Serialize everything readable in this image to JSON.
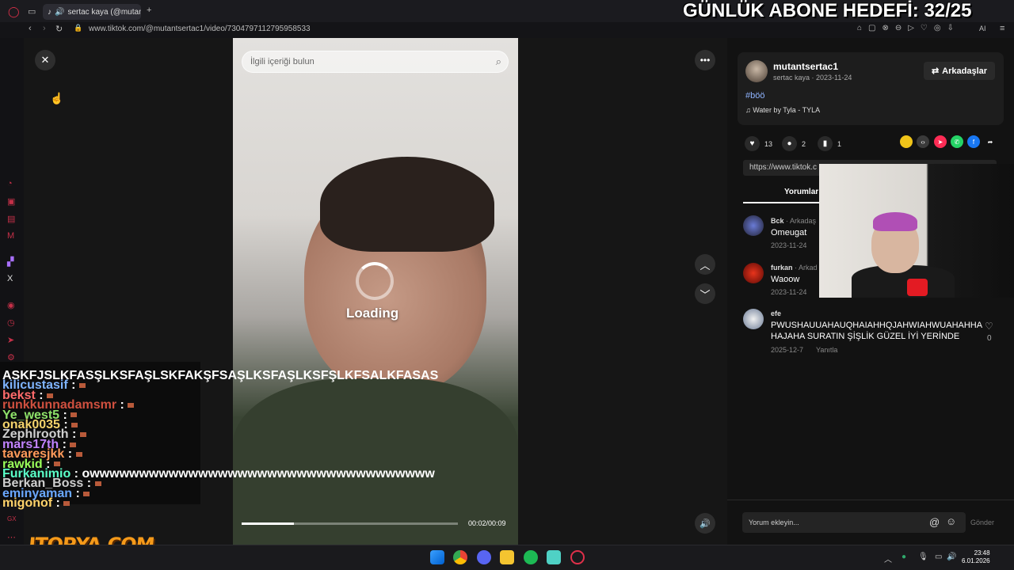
{
  "browser": {
    "tab_title": "sertac kaya (@mutantse",
    "url": "www.tiktok.com/@mutantsertac1/video/7304797112795958533",
    "new_tab_label": "+"
  },
  "overlay": {
    "headline": "GÜNLÜK ABONE HEDEFİ: 32/25",
    "sponsor_logo": "ITOPYA.COM"
  },
  "video": {
    "search_placeholder": "İlgili içeriği bulun",
    "loading_text": "Loading",
    "time": "00:02/00:09",
    "progress": 0.24
  },
  "author": {
    "username": "mutantsertac1",
    "nickname": "sertac kaya · 2023-11-24",
    "friends_button": "Arkadaşlar",
    "hashtag": "#böö",
    "music": "Water by Tyla - TYLA"
  },
  "stats": {
    "likes": "13",
    "comments": "2",
    "saves": "1"
  },
  "share_colors": [
    "#f0c419",
    "#3a3a3a",
    "#fe2c55",
    "#25d366",
    "#1877f2",
    "#3a3a3a"
  ],
  "link_text": "https://www.tiktok.c",
  "comments_tab": "Yorumlar",
  "comments": [
    {
      "user": "Bck",
      "badge": "· Arkadaş",
      "text": "Omeugat",
      "date": "2023-11-24"
    },
    {
      "user": "furkan",
      "badge": "· Arkad",
      "text": "Waoow",
      "date": "2023-11-24"
    },
    {
      "user": "efe",
      "badge": "",
      "text": "PWUSHAUUAHAUQHAIAHHQJAHWIAHWUAHAHHA HAJAHA SURATIN ŞİŞLİK GÜZEL İYİ YERİNDE",
      "date": "2025-12-7",
      "reply": "Yanıtla",
      "likes": "0"
    }
  ],
  "comment_input": {
    "placeholder": "Yorum ekleyin...",
    "send": "Gönder"
  },
  "chat": [
    {
      "user": "ASKFJSLKFASŞLKSFAŞLSKFAKŞFSAŞLKSFAŞLKSFŞLKFSALKFASAS",
      "color": "#ffffff",
      "msg": ""
    },
    {
      "user": "kilicustasif",
      "color": "#7fb4ff",
      "msg": ":"
    },
    {
      "user": "bekst",
      "color": "#ff6b6b",
      "msg": ":"
    },
    {
      "user": "runkkunnadamsmr",
      "color": "#d0503f",
      "msg": ":"
    },
    {
      "user": "Ye_west5",
      "color": "#8fe36a",
      "msg": ":"
    },
    {
      "user": "onak0035",
      "color": "#f4d36b",
      "msg": ":"
    },
    {
      "user": "Zephlrooth",
      "color": "#cfcfcf",
      "msg": ":"
    },
    {
      "user": "mars17th",
      "color": "#c183ff",
      "msg": ":"
    },
    {
      "user": "tavaresjkk",
      "color": "#ff9a5a",
      "msg": ":"
    },
    {
      "user": "rawkid",
      "color": "#9aff5a",
      "msg": ":"
    },
    {
      "user": "Furkanimio",
      "color": "#5affc8",
      "msg": ": owwwwwwwwwwwwwwwwwwwwwwwwwwwwwwwwwww"
    },
    {
      "user": "Berkan_Boss",
      "color": "#cfcfcf",
      "msg": ":"
    },
    {
      "user": "eminyaman",
      "color": "#6aa8ff",
      "msg": ":"
    },
    {
      "user": "migonof",
      "color": "#ffd36b",
      "msg": ":"
    }
  ],
  "taskbar": {
    "time": "23:48",
    "date": "6.01.2026"
  }
}
